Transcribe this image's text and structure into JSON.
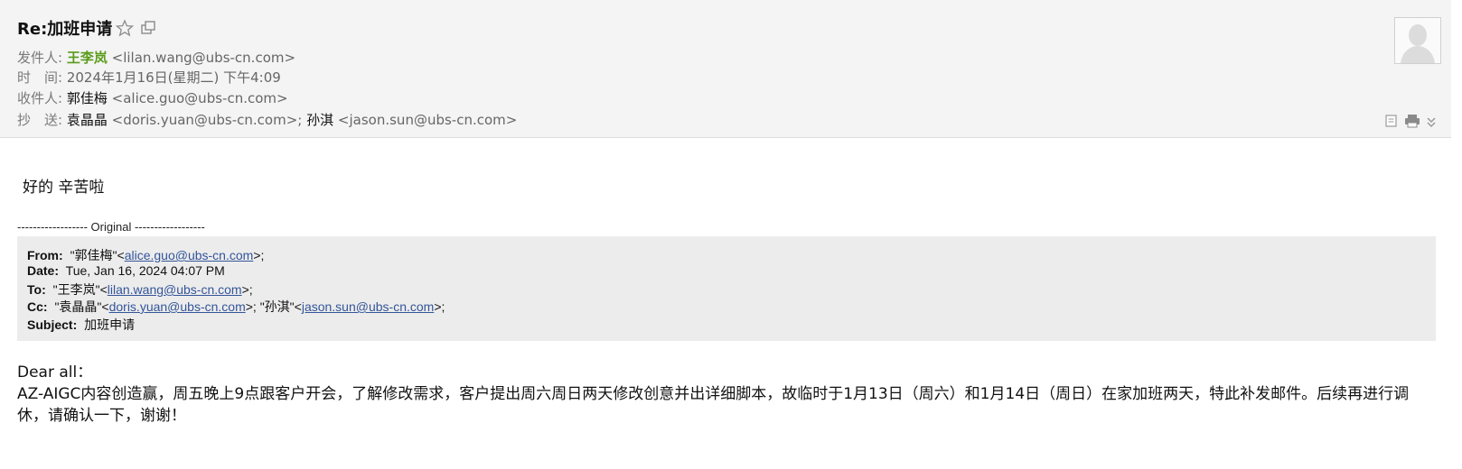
{
  "header": {
    "subject": "Re:加班申请",
    "from_label": "发件人:",
    "from_name": "王李岚",
    "from_addr": "<lilan.wang@ubs-cn.com>",
    "time_label": "时　间:",
    "time_value": "2024年1月16日(星期二) 下午4:09",
    "to_label": "收件人:",
    "to_name": "郭佳梅",
    "to_addr": "<alice.guo@ubs-cn.com>",
    "cc_label": "抄　送:",
    "cc1_name": "袁晶晶",
    "cc1_addr": "<doris.yuan@ubs-cn.com>;",
    "cc2_name": "孙淇",
    "cc2_addr": "<jason.sun@ubs-cn.com>"
  },
  "body": {
    "reply_text": "好的 辛苦啦",
    "original_divider": "------------------ Original ------------------",
    "quote": {
      "from_label": "From:",
      "from_name": "\"郭佳梅\"<",
      "from_link": "alice.guo@ubs-cn.com",
      "from_end": ">;",
      "date_label": "Date:",
      "date_value": "Tue, Jan 16, 2024 04:07 PM",
      "to_label": "To:",
      "to_name": "\"王李岚\"<",
      "to_link": "lilan.wang@ubs-cn.com",
      "to_end": ">;",
      "cc_label": "Cc:",
      "cc1_name": "\"袁晶晶\"<",
      "cc1_link": "doris.yuan@ubs-cn.com",
      "cc_mid": ">; \"孙淇\"<",
      "cc2_link": "jason.sun@ubs-cn.com",
      "cc_end": ">;",
      "subject_label": "Subject:",
      "subject_value": "加班申请"
    },
    "greeting": "Dear all：",
    "paragraph": "AZ-AIGC内容创造赢，周五晚上9点跟客户开会，了解修改需求，客户提出周六周日两天修改创意并出详细脚本，故临时于1月13日（周六）和1月14日（周日）在家加班两天，特此补发邮件。后续再进行调休，请确认一下，谢谢！"
  },
  "icons": [
    "star-icon",
    "popout-icon",
    "avatar-icon",
    "note-icon",
    "print-icon",
    "expand-icon"
  ]
}
